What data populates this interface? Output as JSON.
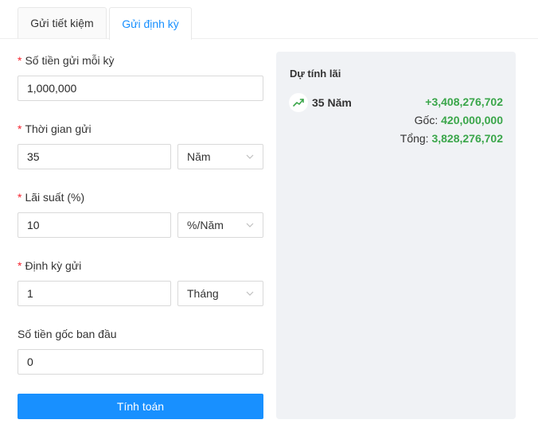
{
  "tabs": [
    {
      "label": "Gửi tiết kiệm",
      "active": false
    },
    {
      "label": "Gửi định kỳ",
      "active": true
    }
  ],
  "form": {
    "amount_per_period": {
      "label": "Số tiền gửi mỗi kỳ",
      "required": true,
      "value": "1,000,000"
    },
    "deposit_time": {
      "label": "Thời gian gửi",
      "required": true,
      "value": "35",
      "unit": "Năm"
    },
    "interest_rate": {
      "label": "Lãi suất (%)",
      "required": true,
      "value": "10",
      "unit": "%/Năm"
    },
    "deposit_period": {
      "label": "Định kỳ gửi",
      "required": true,
      "value": "1",
      "unit": "Tháng"
    },
    "initial_principal": {
      "label": "Số tiền gốc ban đầu",
      "required": false,
      "value": "0"
    },
    "submit_label": "Tính toán"
  },
  "result": {
    "title": "Dự tính lãi",
    "term": "35 Năm",
    "interest": "+3,408,276,702",
    "principal_label": "Gốc:",
    "principal_value": "420,000,000",
    "total_label": "Tổng:",
    "total_value": "3,828,276,702",
    "icon": "trending-up-icon"
  },
  "colors": {
    "accent": "#1890ff",
    "positive": "#3aa64a",
    "required": "#f5222d",
    "panel_bg": "#f0f2f5"
  }
}
